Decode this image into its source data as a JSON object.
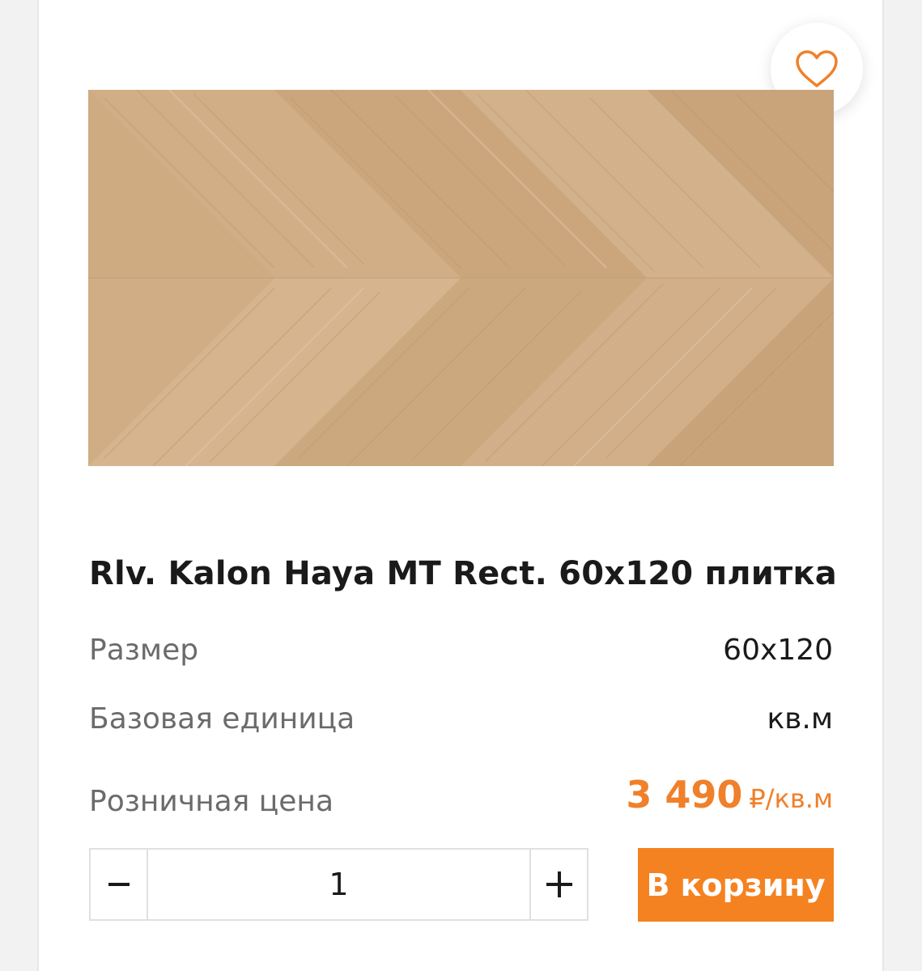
{
  "product": {
    "title": "Rlv. Kalon Haya MT Rect. 60x120 плитка",
    "image_icon": "wood-herringbone-tile-image"
  },
  "specs": [
    {
      "label": "Размер",
      "value": "60x120"
    },
    {
      "label": "Базовая единица",
      "value": "кв.м"
    }
  ],
  "price": {
    "label": "Розничная цена",
    "value": "3 490",
    "unit": "₽/кв.м"
  },
  "quantity": {
    "value": "1",
    "minus_icon": "minus-icon",
    "plus_icon": "plus-icon"
  },
  "actions": {
    "cart_label": "В корзину",
    "favorite_icon": "heart-icon"
  },
  "colors": {
    "accent": "#f58220",
    "price": "#f0802a",
    "title": "#1a1a1a",
    "label": "#6b6b6b"
  }
}
